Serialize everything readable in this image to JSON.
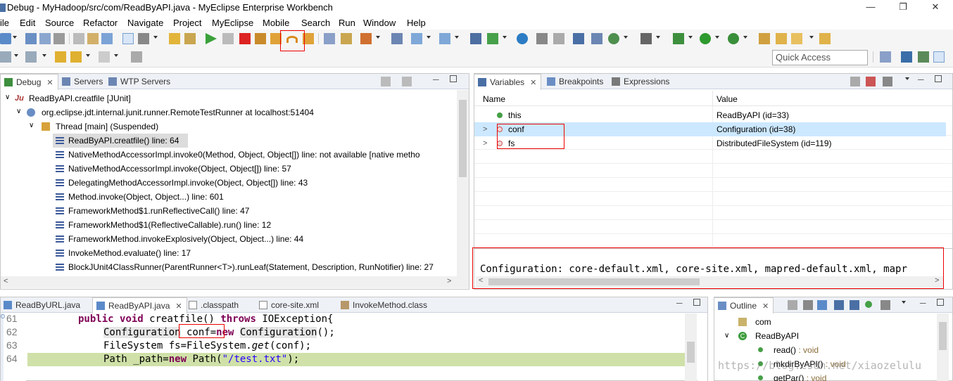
{
  "window": {
    "title": "Debug - MyHadoop/src/com/ReadByAPI.java - MyEclipse Enterprise Workbench"
  },
  "menu": [
    "File",
    "Edit",
    "Source",
    "Refactor",
    "Navigate",
    "Project",
    "MyEclipse",
    "Mobile",
    "Search",
    "Run",
    "Window",
    "Help"
  ],
  "menu_first_visible": "ile",
  "quick_access": {
    "placeholder": "Quick Access"
  },
  "debug_view": {
    "tabs": [
      {
        "label": "Debug",
        "active": true
      },
      {
        "label": "Servers",
        "active": false
      },
      {
        "label": "WTP Servers",
        "active": false
      }
    ],
    "launch": "ReadByAPI.creatfile [JUnit]",
    "process": "org.eclipse.jdt.internal.junit.runner.RemoteTestRunner at localhost:51404",
    "thread": "Thread [main] (Suspended)",
    "frames": [
      "ReadByAPI.creatfile() line: 64",
      "NativeMethodAccessorImpl.invoke0(Method, Object, Object[]) line: not available [native metho",
      "NativeMethodAccessorImpl.invoke(Object, Object[]) line: 57",
      "DelegatingMethodAccessorImpl.invoke(Object, Object[]) line: 43",
      "Method.invoke(Object, Object...) line: 601",
      "FrameworkMethod$1.runReflectiveCall() line: 47",
      "FrameworkMethod$1(ReflectiveCallable).run() line: 12",
      "FrameworkMethod.invokeExplosively(Object, Object...) line: 44",
      "InvokeMethod.evaluate() line: 17",
      "BlockJUnit4ClassRunner(ParentRunner<T>).runLeaf(Statement, Description, RunNotifier) line: 27"
    ]
  },
  "variables_view": {
    "tabs": [
      {
        "label": "Variables",
        "active": true
      },
      {
        "label": "Breakpoints",
        "active": false
      },
      {
        "label": "Expressions",
        "active": false
      }
    ],
    "columns": {
      "name": "Name",
      "value": "Value"
    },
    "rows": [
      {
        "name": "this",
        "value": "ReadByAPI  (id=33)"
      },
      {
        "name": "conf",
        "value": "Configuration  (id=38)"
      },
      {
        "name": "fs",
        "value": "DistributedFileSystem  (id=119)"
      }
    ],
    "detail": "Configuration: core-default.xml, core-site.xml, mapred-default.xml, mapr"
  },
  "editor": {
    "tabs": [
      {
        "label": "ReadByURL.java",
        "active": false
      },
      {
        "label": "ReadByAPI.java",
        "active": true
      },
      {
        "label": ".classpath",
        "active": false
      },
      {
        "label": "core-site.xml",
        "active": false
      },
      {
        "label": "InvokeMethod.class",
        "active": false
      }
    ],
    "line_numbers": [
      "61",
      "62",
      "63",
      "64"
    ],
    "code": {
      "l61_kw1": "public",
      "l61_kw2": "void",
      "l61_rest": " creatfile() ",
      "l61_kw3": "throws",
      "l61_end": " IOException{",
      "l62_type": "Configuration",
      "l62_var": " conf=",
      "l62_kw": "new",
      "l62_ctor": "Configuration",
      "l62_end": "();",
      "l63_a": "FileSystem fs=FileSystem.",
      "l63_method": "get",
      "l63_b": "(conf);",
      "l64_a": "Path _path=",
      "l64_kw": "new",
      "l64_b": " Path(",
      "l64_str": "\"/test.txt\"",
      "l64_end": ");"
    }
  },
  "outline": {
    "tab": "Outline",
    "items": [
      {
        "label": "com",
        "suffix": ""
      },
      {
        "label": "ReadByAPI",
        "suffix": ""
      },
      {
        "label": "read()",
        "suffix": " : void"
      },
      {
        "label": "mkdirByAPI()",
        "suffix": " : void"
      },
      {
        "label": "getPar()",
        "suffix": " : void"
      }
    ]
  },
  "watermark": "https://blog.csdn.net/xiaozelulu",
  "colors": {
    "debug_line_highlight": "#cfe1a8",
    "selection": "#cce8ff",
    "annotation_red": "#e00000",
    "keyword": "#7f0055",
    "string": "#2a00ff"
  }
}
